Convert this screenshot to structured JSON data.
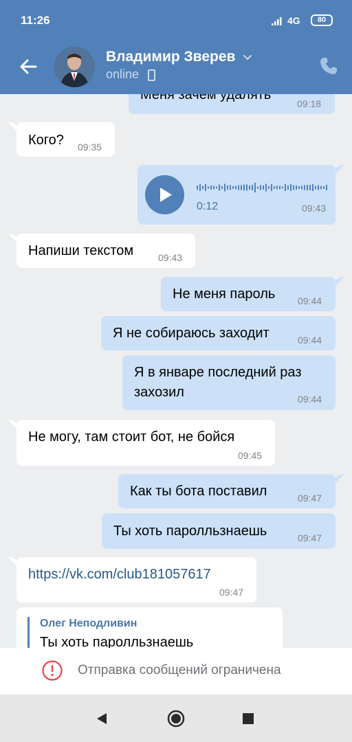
{
  "status": {
    "time": "11:26",
    "network": "4G",
    "battery": "80"
  },
  "header": {
    "name": "Владимир Зверев",
    "presence": "online"
  },
  "messages": [
    {
      "dir": "out",
      "text": "Меня зачем удалять",
      "time": "09:18"
    },
    {
      "dir": "in",
      "text": "Кого?",
      "time": "09:35"
    },
    {
      "dir": "out",
      "type": "voice",
      "duration": "0:12",
      "time": "09:43"
    },
    {
      "dir": "in",
      "text": "Напиши текстом",
      "time": "09:43"
    },
    {
      "dir": "out",
      "text": "Не меня пароль",
      "time": "09:44"
    },
    {
      "dir": "out",
      "text": "Я не собираюсь заходит",
      "time": "09:44"
    },
    {
      "dir": "out",
      "text_line1": "Я в январе последний раз",
      "text_line2": "захозил",
      "time": "09:44"
    },
    {
      "dir": "in",
      "text": "Не могу, там стоит бот, не бойся",
      "time": "09:45"
    },
    {
      "dir": "out",
      "text": "Как ты бота поставил",
      "time": "09:47"
    },
    {
      "dir": "out",
      "text": "Ты хоть паролльзнаешь",
      "time": "09:47"
    },
    {
      "dir": "in",
      "type": "link",
      "text": "https://vk.com/club181057617",
      "time": "09:47"
    },
    {
      "dir": "in",
      "type": "reply",
      "quote_author": "Олег Неподливин",
      "quote_text": "Ты хоть паролльзнаешь"
    }
  ],
  "footer": {
    "restriction": "Отправка сообщений ограничена"
  },
  "colors": {
    "header": "#5181b8",
    "outgoing": "#cce1f8",
    "incoming": "#ffffff",
    "warning": "#e64646"
  },
  "icons": {
    "back": "arrow-left-icon",
    "call": "phone-icon",
    "play": "play-icon",
    "warning": "exclamation-circle-icon"
  }
}
